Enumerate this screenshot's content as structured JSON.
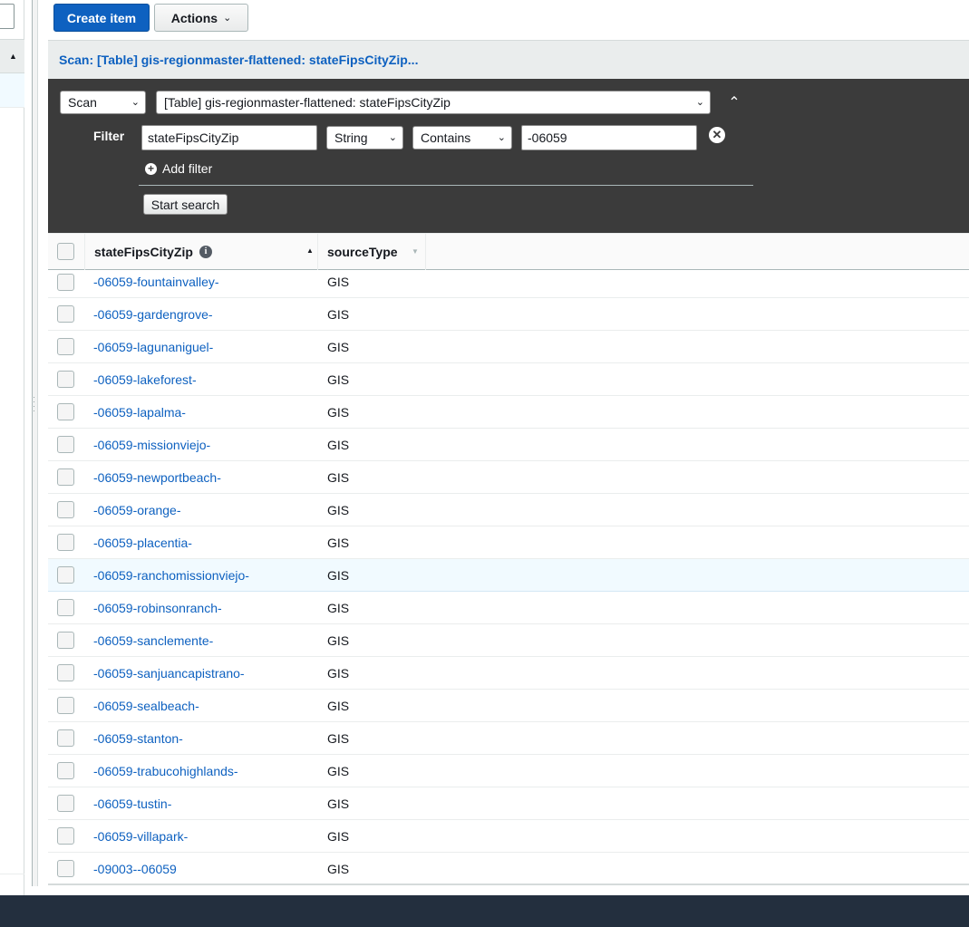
{
  "toolbar": {
    "create_label": "Create item",
    "actions_label": "Actions"
  },
  "panel": {
    "title": "Scan: [Table] gis-regionmaster-flattened: stateFipsCityZip..."
  },
  "query": {
    "mode": "Scan",
    "table_select": "[Table] gis-regionmaster-flattened: stateFipsCityZip",
    "filter_label": "Filter",
    "filter_attribute": "stateFipsCityZip",
    "filter_type": "String",
    "filter_condition": "Contains",
    "filter_value": "-06059",
    "add_filter_label": "Add filter",
    "start_label": "Start search"
  },
  "table": {
    "columns": [
      "stateFipsCityZip",
      "sourceType"
    ],
    "sort_column": "stateFipsCityZip",
    "sort_direction": "ascending",
    "rows": [
      {
        "key": "-06059-fountainvalley-",
        "source": "GIS"
      },
      {
        "key": "-06059-gardengrove-",
        "source": "GIS"
      },
      {
        "key": "-06059-lagunaniguel-",
        "source": "GIS"
      },
      {
        "key": "-06059-lakeforest-",
        "source": "GIS"
      },
      {
        "key": "-06059-lapalma-",
        "source": "GIS"
      },
      {
        "key": "-06059-missionviejo-",
        "source": "GIS"
      },
      {
        "key": "-06059-newportbeach-",
        "source": "GIS"
      },
      {
        "key": "-06059-orange-",
        "source": "GIS"
      },
      {
        "key": "-06059-placentia-",
        "source": "GIS"
      },
      {
        "key": "-06059-ranchomissionviejo-",
        "source": "GIS",
        "hovered": true
      },
      {
        "key": "-06059-robinsonranch-",
        "source": "GIS"
      },
      {
        "key": "-06059-sanclemente-",
        "source": "GIS"
      },
      {
        "key": "-06059-sanjuancapistrano-",
        "source": "GIS"
      },
      {
        "key": "-06059-sealbeach-",
        "source": "GIS"
      },
      {
        "key": "-06059-stanton-",
        "source": "GIS"
      },
      {
        "key": "-06059-trabucohighlands-",
        "source": "GIS"
      },
      {
        "key": "-06059-tustin-",
        "source": "GIS"
      },
      {
        "key": "-06059-villapark-",
        "source": "GIS"
      },
      {
        "key": "-09003--06059",
        "source": "GIS"
      }
    ]
  },
  "colors": {
    "primary": "#0e61c0",
    "filter_panel": "#3b3b3b",
    "footer": "#232f3e",
    "hover_row": "#f1faff"
  }
}
